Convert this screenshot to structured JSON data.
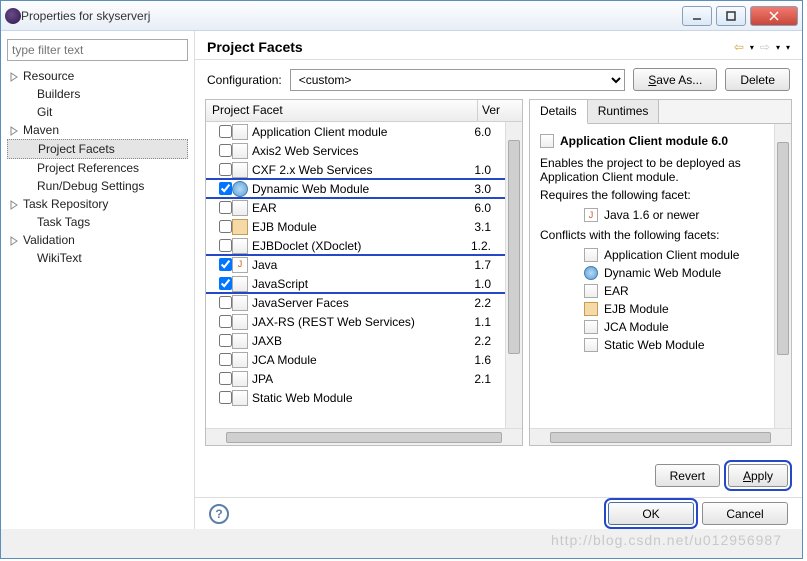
{
  "titlebar": {
    "title": "Properties for skyserverj"
  },
  "sidebar": {
    "filter_placeholder": "type filter text",
    "items": [
      {
        "label": "Resource",
        "expandable": true
      },
      {
        "label": "Builders"
      },
      {
        "label": "Git"
      },
      {
        "label": "Maven",
        "expandable": true
      },
      {
        "label": "Project Facets",
        "selected": true
      },
      {
        "label": "Project References"
      },
      {
        "label": "Run/Debug Settings"
      },
      {
        "label": "Task Repository",
        "expandable": true
      },
      {
        "label": "Task Tags"
      },
      {
        "label": "Validation",
        "expandable": true
      },
      {
        "label": "WikiText"
      }
    ]
  },
  "main": {
    "heading": "Project Facets",
    "config_label": "Configuration:",
    "config_value": "<custom>",
    "save_as": "Save As...",
    "delete": "Delete",
    "col_facet": "Project Facet",
    "col_ver": "Ver",
    "facets": [
      {
        "label": "Application Client module",
        "ver": "6.0",
        "checked": false,
        "icon": "doc"
      },
      {
        "label": "Axis2 Web Services",
        "ver": "",
        "checked": false,
        "icon": "doc"
      },
      {
        "label": "CXF 2.x Web Services",
        "ver": "1.0",
        "checked": false,
        "icon": "doc"
      },
      {
        "label": "Dynamic Web Module",
        "ver": "3.0",
        "checked": true,
        "icon": "globe",
        "highlight": 1
      },
      {
        "label": "EAR",
        "ver": "6.0",
        "checked": false,
        "icon": "doc"
      },
      {
        "label": "EJB Module",
        "ver": "3.1",
        "checked": false,
        "icon": "jar"
      },
      {
        "label": "EJBDoclet (XDoclet)",
        "ver": "1.2.",
        "checked": false,
        "icon": "doc"
      },
      {
        "label": "Java",
        "ver": "1.7",
        "checked": true,
        "icon": "java",
        "highlight": 2
      },
      {
        "label": "JavaScript",
        "ver": "1.0",
        "checked": true,
        "icon": "doc",
        "highlight": 2
      },
      {
        "label": "JavaServer Faces",
        "ver": "2.2",
        "checked": false,
        "icon": "doc"
      },
      {
        "label": "JAX-RS (REST Web Services)",
        "ver": "1.1",
        "checked": false,
        "icon": "doc"
      },
      {
        "label": "JAXB",
        "ver": "2.2",
        "checked": false,
        "icon": "doc"
      },
      {
        "label": "JCA Module",
        "ver": "1.6",
        "checked": false,
        "icon": "doc"
      },
      {
        "label": "JPA",
        "ver": "2.1",
        "checked": false,
        "icon": "doc"
      },
      {
        "label": "Static Web Module",
        "ver": "",
        "checked": false,
        "icon": "doc"
      }
    ],
    "tabs": {
      "details": "Details",
      "runtimes": "Runtimes"
    },
    "details": {
      "title": "Application Client module 6.0",
      "desc": "Enables the project to be deployed as Application Client module.",
      "requires_h": "Requires the following facet:",
      "requires": "Java 1.6 or newer",
      "conflicts_h": "Conflicts with the following facets:",
      "conflicts": [
        "Application Client module",
        "Dynamic Web Module",
        "EAR",
        "EJB Module",
        "JCA Module",
        "Static Web Module"
      ]
    },
    "buttons": {
      "revert": "Revert",
      "apply": "Apply",
      "ok": "OK",
      "cancel": "Cancel"
    }
  },
  "watermark": "http://blog.csdn.net/u012956987"
}
